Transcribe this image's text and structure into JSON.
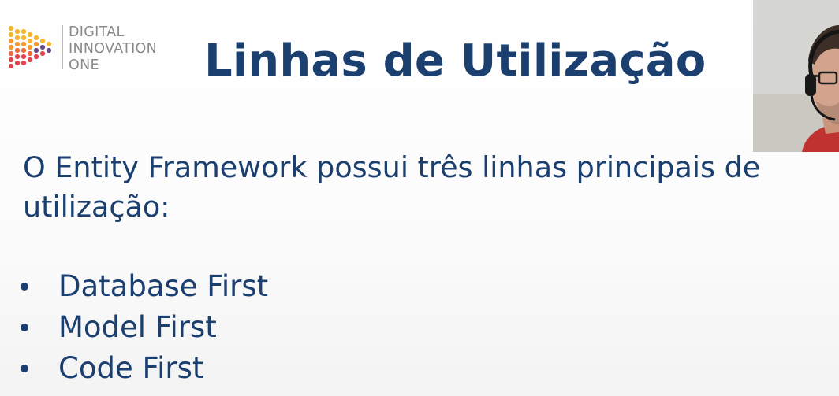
{
  "logo": {
    "lines": [
      "DIGITAL",
      "INNOVATION",
      "ONE"
    ],
    "colors": [
      "#f7b52c",
      "#f39a2a",
      "#ec6a3d",
      "#e2434f"
    ]
  },
  "slide": {
    "title": "Linhas de Utilização",
    "intro": "O Entity Framework possui três linhas principais de utilização:",
    "bullets": [
      "Database First",
      "Model First",
      "Code First"
    ]
  },
  "webcam": {
    "subject": "person-with-headset"
  },
  "colors": {
    "text": "#1b3f6f",
    "logo_text": "#8a8a8a"
  }
}
